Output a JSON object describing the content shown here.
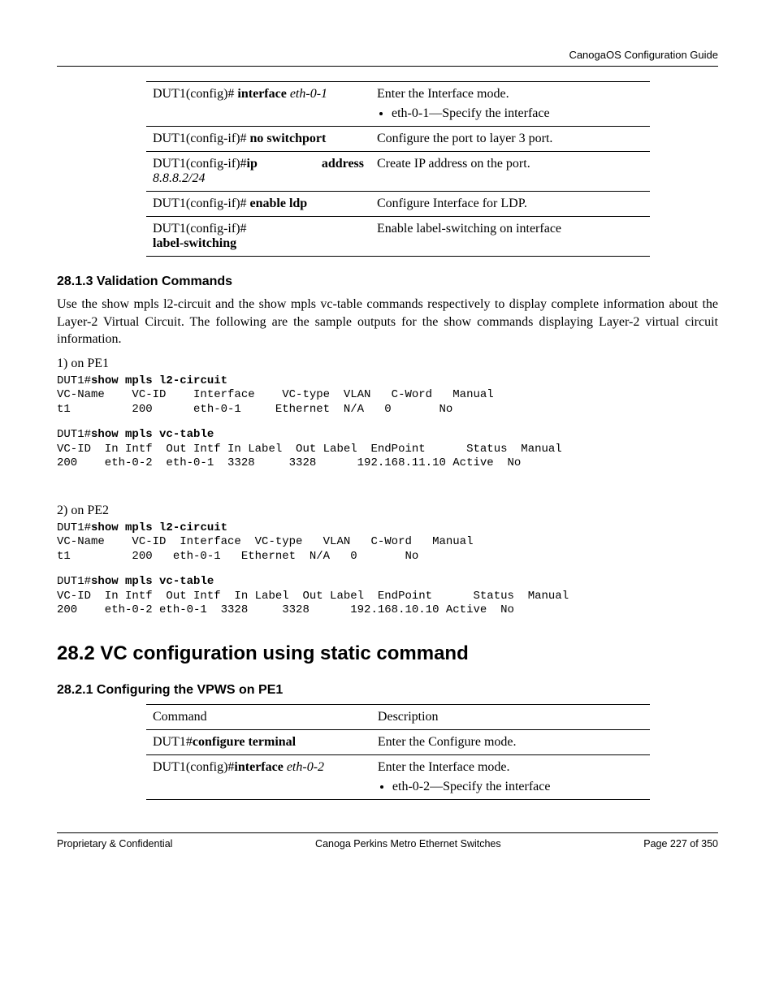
{
  "header": {
    "title": "CanogaOS Configuration Guide"
  },
  "table1": {
    "rows": [
      {
        "cmd_prefix": "DUT1(config)# ",
        "cmd_bold": "interface",
        "cmd_italic": " eth-0-1",
        "desc": "Enter the Interface mode.",
        "bullet": "eth-0-1—Specify the interface"
      },
      {
        "cmd_prefix": "DUT1(config-if)# ",
        "cmd_bold": "no switchport",
        "cmd_italic": "",
        "desc": "Configure the port to layer 3 port."
      },
      {
        "cmd_left": "DUT1(config-if)#",
        "cmd_bold_left": "ip",
        "cmd_bold_right": "address",
        "cmd_italic_line2": "8.8.8.2/24",
        "desc": "Create IP address on the port."
      },
      {
        "cmd_prefix": "DUT1(config-if)# ",
        "cmd_bold": "enable ldp",
        "cmd_italic": "",
        "desc": "Configure Interface for LDP."
      },
      {
        "cmd_prefix": "DUT1(config-if)# ",
        "cmd_bold_line2": "label-switching",
        "desc": "Enable label-switching on interface"
      }
    ]
  },
  "sec_28_1_3": {
    "title": "28.1.3 Validation Commands",
    "para": "Use the show mpls l2-circuit and the show mpls vc-table commands respectively to display complete information about the Layer-2 Virtual Circuit. The following are the sample outputs for the show commands displaying Layer-2 virtual circuit information."
  },
  "pe1": {
    "label": "1)  on PE1",
    "block1_cmd": "show mpls l2-circuit",
    "block1_body": "VC-Name    VC-ID    Interface    VC-type  VLAN   C-Word   Manual\nt1         200      eth-0-1     Ethernet  N/A   0       No",
    "block2_cmd": "show mpls vc-table",
    "block2_body": "VC-ID  In Intf  Out Intf In Label  Out Label  EndPoint      Status  Manual\n200    eth-0-2  eth-0-1  3328     3328      192.168.11.10 Active  No"
  },
  "pe2": {
    "label": "2) on PE2",
    "block1_cmd": "show mpls l2-circuit",
    "block1_body": "VC-Name    VC-ID  Interface  VC-type   VLAN   C-Word   Manual\nt1         200   eth-0-1   Ethernet  N/A   0       No",
    "block2_cmd": "show mpls vc-table",
    "block2_body": "VC-ID  In Intf  Out Intf  In Label  Out Label  EndPoint      Status  Manual\n200    eth-0-2 eth-0-1  3328     3328      192.168.10.10 Active  No"
  },
  "sec_28_2": {
    "title": "28.2  VC configuration using static command"
  },
  "sec_28_2_1": {
    "title": "28.2.1 Configuring the VPWS on PE1"
  },
  "table2": {
    "head_cmd": "Command",
    "head_desc": "Description",
    "rows": [
      {
        "cmd_prefix": "DUT1#",
        "cmd_bold": "configure terminal",
        "cmd_italic": "",
        "desc": "Enter the Configure mode."
      },
      {
        "cmd_prefix": "DUT1(config)#",
        "cmd_bold": "interface",
        "cmd_italic": " eth-0-2",
        "desc": "Enter the Interface mode.",
        "bullet": "eth-0-2—Specify the interface"
      }
    ]
  },
  "footer": {
    "left": "Proprietary & Confidential",
    "center": "Canoga Perkins Metro Ethernet Switches",
    "right": "Page 227 of 350"
  },
  "prompt": "DUT1#"
}
